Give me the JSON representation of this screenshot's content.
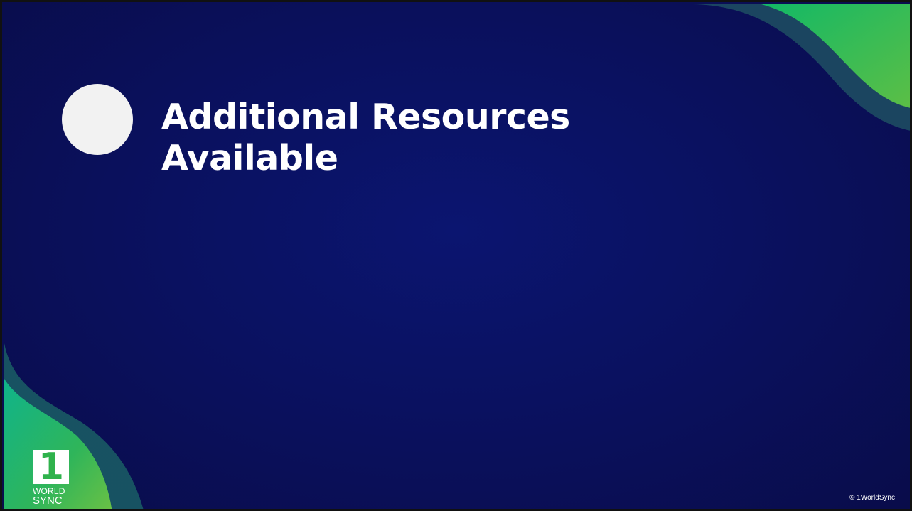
{
  "slide": {
    "title_line1": "Additional Resources",
    "title_line2": "Available",
    "copyright": "© 1WorldSync",
    "logo": {
      "mark": "1",
      "word1": "WORLD",
      "word2": "SYNC"
    }
  },
  "colors": {
    "background": "#0a1160",
    "accent_green": "#2fb24c",
    "accent_teal": "#12b07a",
    "circle": "#f2f2f2",
    "text": "#ffffff"
  },
  "icons": {
    "placeholder": "circle-placeholder-icon",
    "logo": "1worldsync-logo-icon"
  }
}
